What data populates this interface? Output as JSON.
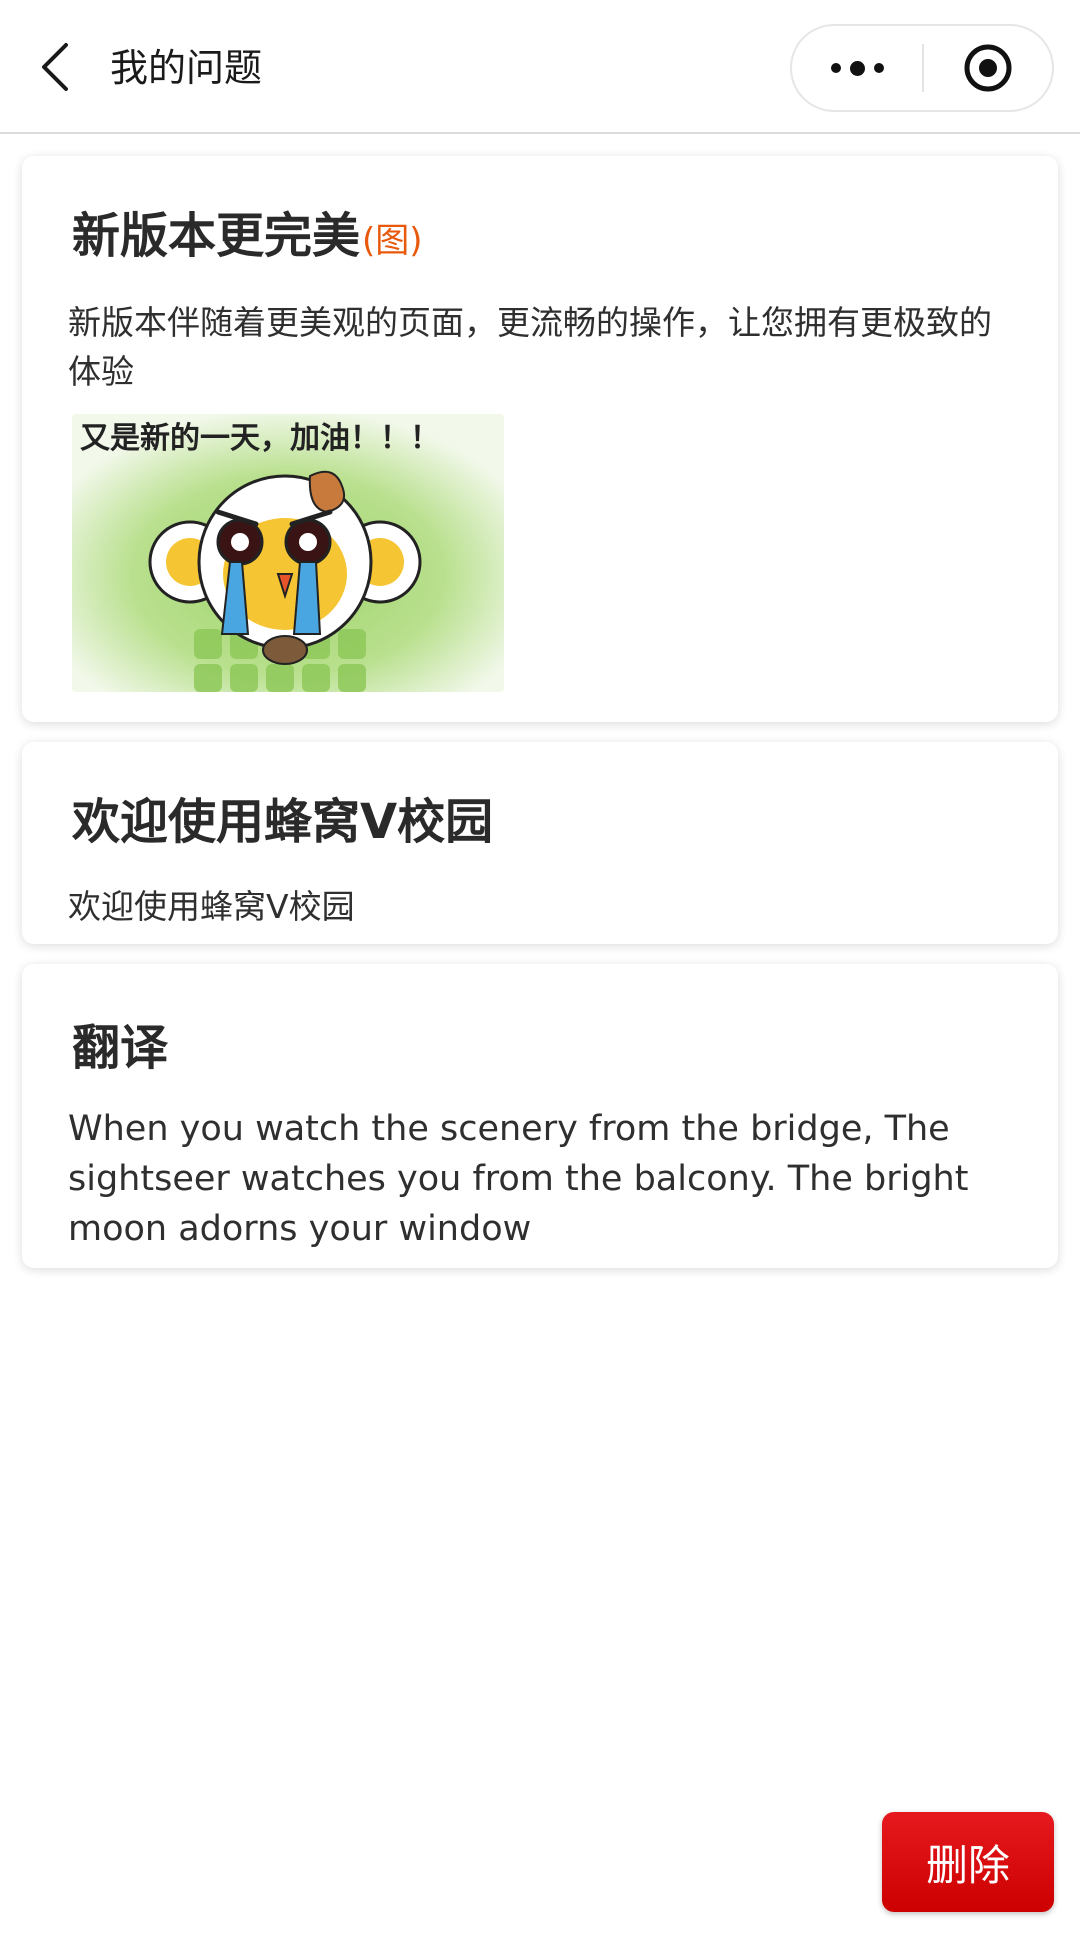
{
  "navbar": {
    "title": "我的问题",
    "back_icon": "chevron-left-icon",
    "more_icon": "more-dots-icon",
    "close_icon": "target-circle-icon"
  },
  "questions": [
    {
      "title": "新版本更完美",
      "image_tag": "(图)",
      "body": "新版本伴随着更美观的页面，更流畅的操作，让您拥有更极致的体验",
      "image_caption": "又是新的一天，加油！！！"
    },
    {
      "title": "欢迎使用蜂窝V校园",
      "body": "欢迎使用蜂窝V校园"
    },
    {
      "title": "翻译",
      "body": "When you watch the scenery from the bridge, The sightseer watches you from the balcony. The bright moon adorns your window"
    }
  ],
  "delete_button": {
    "label": "删除"
  },
  "colors": {
    "accent_red": "#d40000",
    "image_tag_orange": "#e8590c",
    "text_dark": "#2a2a2a"
  }
}
